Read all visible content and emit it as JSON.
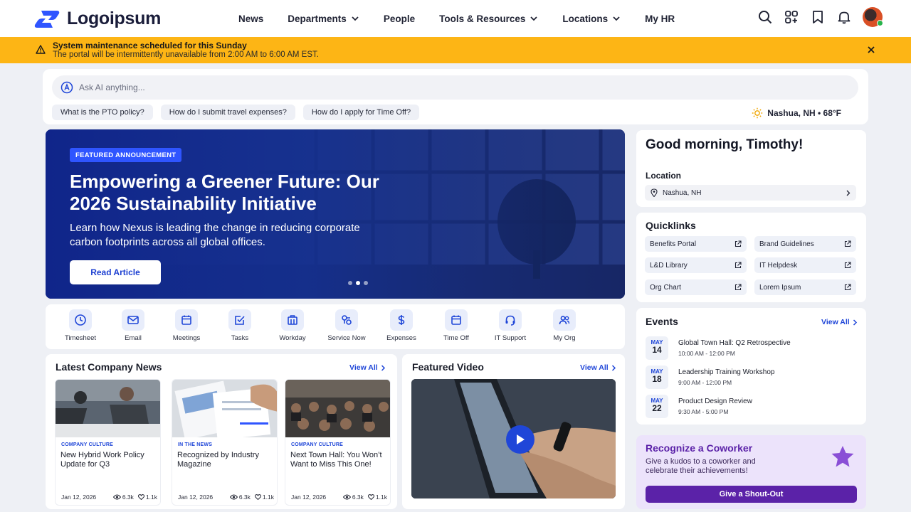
{
  "header": {
    "logo_text": "Logoipsum",
    "nav": [
      {
        "label": "News",
        "dropdown": false
      },
      {
        "label": "Departments",
        "dropdown": true
      },
      {
        "label": "People",
        "dropdown": false
      },
      {
        "label": "Tools & Resources",
        "dropdown": true
      },
      {
        "label": "Locations",
        "dropdown": true
      },
      {
        "label": "My HR",
        "dropdown": false
      }
    ],
    "icons": [
      "search-icon",
      "apps-icon",
      "bookmark-icon",
      "bell-icon",
      "avatar"
    ]
  },
  "banner": {
    "title": "System maintenance scheduled for this Sunday",
    "message": "The portal will be intermittently unavailable from 2:00 AM to 6:00 AM EST."
  },
  "ai": {
    "placeholder": "Ask AI anything...",
    "suggestions": [
      "What is the PTO policy?",
      "How do I submit travel expenses?",
      "How do I apply for Time Off?"
    ],
    "weather": "Nashua, NH • 68°F"
  },
  "hero": {
    "badge": "FEATURED ANNOUNCEMENT",
    "title": "Empowering a Greener Future: Our 2026 Sustainability Initiative",
    "subtitle": "Learn how Nexus is leading the change in reducing corporate carbon footprints across all global offices.",
    "button": "Read Article",
    "slides": 3,
    "active_slide": 2
  },
  "apps": [
    "Timesheet",
    "Email",
    "Meetings",
    "Tasks",
    "Workday",
    "Service Now",
    "Expenses",
    "Time Off",
    "IT Support",
    "My Org"
  ],
  "news": {
    "title": "Latest Company News",
    "view_all": "View All",
    "articles": [
      {
        "category": "COMPANY CULTURE",
        "title": "New Hybrid Work Policy Update for Q3",
        "date": "Jan 12, 2026",
        "views": "6.3k",
        "likes": "1.1k"
      },
      {
        "category": "IN THE NEWS",
        "title": "Recognized by Industry Magazine",
        "date": "Jan 12, 2026",
        "views": "6.3k",
        "likes": "1.1k"
      },
      {
        "category": "COMPANY CULTURE",
        "title": "Next Town Hall: You Won’t Want to Miss This One!",
        "date": "Jan 12, 2026",
        "views": "6.3k",
        "likes": "1.1k"
      }
    ]
  },
  "video": {
    "title": "Featured Video",
    "view_all": "View All"
  },
  "greeting": {
    "text": "Good morning, Timothy!",
    "location_label": "Location",
    "location": "Nashua, NH"
  },
  "quicklinks": {
    "title": "Quicklinks",
    "items": [
      "Benefits Portal",
      "Brand Guidelines",
      "L&D Library",
      "IT Helpdesk",
      "Org Chart",
      "Lorem Ipsum"
    ]
  },
  "events": {
    "title": "Events",
    "view_all": "View All",
    "items": [
      {
        "month": "MAY",
        "day": "14",
        "title": "Global Town Hall: Q2 Retrospective",
        "time": "10:00 AM - 12:00 PM"
      },
      {
        "month": "MAY",
        "day": "18",
        "title": "Leadership Training Workshop",
        "time": "9:00 AM - 12:00 PM"
      },
      {
        "month": "MAY",
        "day": "22",
        "title": "Product Design Review",
        "time": "9:30 AM - 5:00 PM"
      }
    ]
  },
  "kudos": {
    "title": "Recognize a Coworker",
    "description": "Give a kudos to a coworker and celebrate their achievements!",
    "button": "Give a Shout-Out"
  },
  "colors": {
    "primary": "#1f46d8",
    "banner": "#fdb515",
    "hero": "#142c94",
    "kudos_bg": "#ece3fb",
    "kudos_accent": "#5b22a8"
  }
}
